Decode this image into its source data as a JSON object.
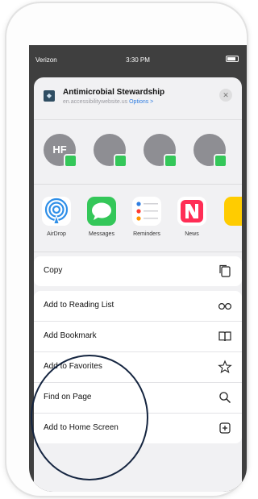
{
  "status_bar": {
    "carrier": "Verizon",
    "time": "3:30 PM"
  },
  "share_header": {
    "title": "Antimicrobial Stewardship",
    "subtitle": "en.accessibilitywebsite.us",
    "options_label": "Options >"
  },
  "contacts": [
    {
      "initials": "HF"
    },
    {
      "initials": ""
    },
    {
      "initials": ""
    },
    {
      "initials": ""
    }
  ],
  "apps": [
    {
      "label": "AirDrop",
      "icon": "airdrop-icon"
    },
    {
      "label": "Messages",
      "icon": "messages-icon"
    },
    {
      "label": "Reminders",
      "icon": "reminders-icon"
    },
    {
      "label": "News",
      "icon": "news-icon"
    }
  ],
  "actions": {
    "copy": "Copy",
    "add_reading_list": "Add to Reading List",
    "add_bookmark": "Add Bookmark",
    "add_favorites": "Add to Favorites",
    "find_on_page": "Find on Page",
    "add_home_screen": "Add to Home Screen"
  },
  "colors": {
    "highlight_circle": "#152540",
    "messages_green": "#34c759",
    "link_blue": "#2f7de1"
  }
}
